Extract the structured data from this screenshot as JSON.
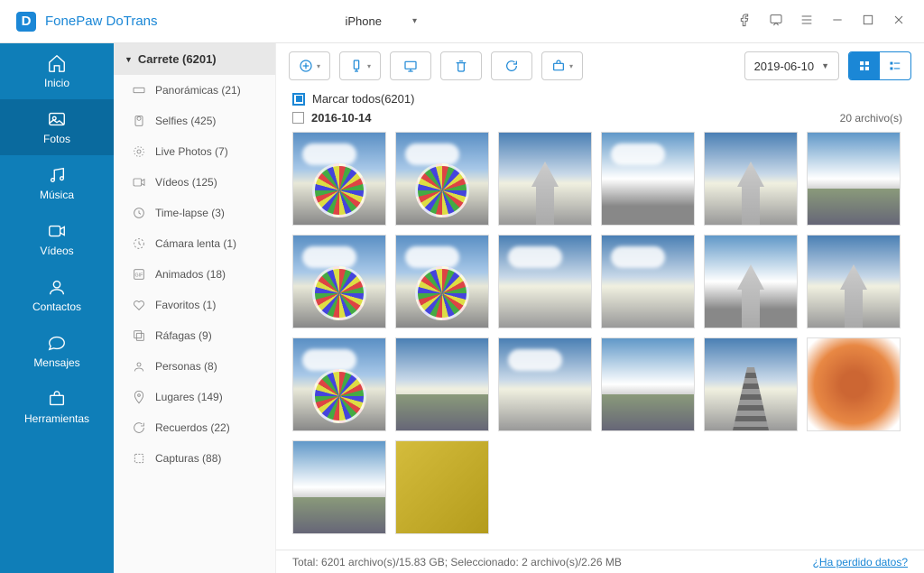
{
  "app_title": "FonePaw DoTrans",
  "device": {
    "name": "iPhone"
  },
  "sidebar": [
    {
      "id": "inicio",
      "label": "Inicio"
    },
    {
      "id": "fotos",
      "label": "Fotos",
      "active": true
    },
    {
      "id": "musica",
      "label": "Música"
    },
    {
      "id": "videos",
      "label": "Vídeos"
    },
    {
      "id": "contactos",
      "label": "Contactos"
    },
    {
      "id": "mensajes",
      "label": "Mensajes"
    },
    {
      "id": "herramientas",
      "label": "Herramientas"
    }
  ],
  "albums": {
    "header": "Carrete (6201)",
    "items": [
      {
        "label": "Panorámicas (21)"
      },
      {
        "label": "Selfies (425)"
      },
      {
        "label": "Live Photos (7)"
      },
      {
        "label": "Vídeos (125)"
      },
      {
        "label": "Time-lapse (3)"
      },
      {
        "label": "Cámara lenta (1)"
      },
      {
        "label": "Animados (18)"
      },
      {
        "label": "Favoritos (1)"
      },
      {
        "label": "Ráfagas (9)"
      },
      {
        "label": "Personas (8)"
      },
      {
        "label": "Lugares (149)"
      },
      {
        "label": "Recuerdos (22)"
      },
      {
        "label": "Capturas (88)"
      }
    ]
  },
  "toolbar": {
    "date_filter": "2019-06-10"
  },
  "selection": {
    "select_all_label": "Marcar todos(6201)"
  },
  "group": {
    "date": "2016-10-14",
    "count_label": "20 archivo(s)"
  },
  "status": {
    "text": "Total: 6201 archivo(s)/15.83 GB; Seleccionado: 2 archivo(s)/2.26 MB",
    "link": "¿Ha perdido datos?"
  }
}
